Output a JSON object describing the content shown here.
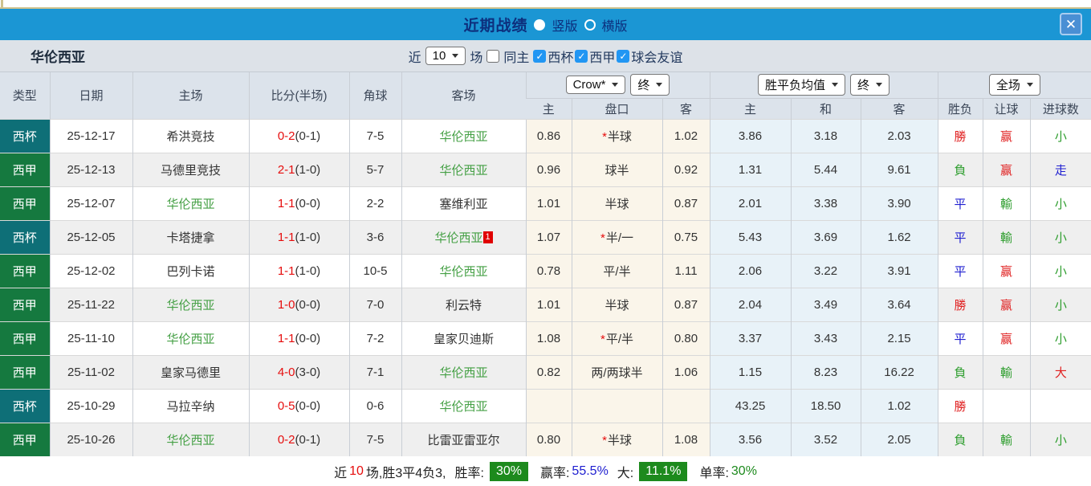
{
  "colors": {
    "accent_blue": "#1b96d4",
    "title_navy": "#0d2f7d",
    "cup_badge": "#0e6f77",
    "league_badge": "#15793f",
    "badge_green": "#1d8a1d",
    "win_red": "#e02020",
    "lose_green": "#2f9e2f",
    "draw_blue": "#2020d0"
  },
  "titlebar": {
    "title": "近期战绩",
    "radio_vertical": "竖版",
    "radio_horizontal": "横版",
    "close_icon": "✕"
  },
  "filterbar": {
    "team": "华伦西亚",
    "near_label": "近",
    "matches_value": "10",
    "matches_suffix": "场",
    "same_home_label": "同主",
    "checkbox_glyph": "✓",
    "filters": [
      {
        "label": "西杯",
        "checked": true
      },
      {
        "label": "西甲",
        "checked": true
      },
      {
        "label": "球会友谊",
        "checked": true
      }
    ]
  },
  "table": {
    "headers_left": [
      "类型",
      "日期",
      "主场",
      "比分(半场)",
      "角球",
      "客场"
    ],
    "group1": {
      "select1": "Crow*",
      "select2": "终",
      "cols": [
        "主",
        "盘口",
        "客"
      ]
    },
    "group2": {
      "select1": "胜平负均值",
      "select2": "终",
      "cols": [
        "主",
        "和",
        "客"
      ]
    },
    "group3": {
      "select1": "全场",
      "cols": [
        "胜负",
        "让球",
        "进球数"
      ]
    },
    "rows": [
      {
        "type": "西杯",
        "type_color": "teal",
        "date": "25-12-17",
        "home": "希洪竞技",
        "home_self": false,
        "score_ft": "0-2",
        "score_ht": "(0-1)",
        "corner": "7-5",
        "away": "华伦西亚",
        "away_self": true,
        "away_badge": "",
        "odds_home": "0.86",
        "handicap": "*半球",
        "odds_away": "1.02",
        "avg_home": "3.86",
        "avg_draw": "3.18",
        "avg_away": "2.03",
        "outcome": {
          "t": "勝",
          "c": "red"
        },
        "handicap_res": {
          "t": "赢",
          "c": "red"
        },
        "goals": {
          "t": "小",
          "c": "green"
        }
      },
      {
        "type": "西甲",
        "type_color": "green",
        "date": "25-12-13",
        "home": "马德里竞技",
        "home_self": false,
        "score_ft": "2-1",
        "score_ht": "(1-0)",
        "corner": "5-7",
        "away": "华伦西亚",
        "away_self": true,
        "away_badge": "",
        "odds_home": "0.96",
        "handicap": "球半",
        "odds_away": "0.92",
        "avg_home": "1.31",
        "avg_draw": "5.44",
        "avg_away": "9.61",
        "outcome": {
          "t": "負",
          "c": "green"
        },
        "handicap_res": {
          "t": "赢",
          "c": "red"
        },
        "goals": {
          "t": "走",
          "c": "blue"
        }
      },
      {
        "type": "西甲",
        "type_color": "green",
        "date": "25-12-07",
        "home": "华伦西亚",
        "home_self": true,
        "score_ft": "1-1",
        "score_ht": "(0-0)",
        "corner": "2-2",
        "away": "塞维利亚",
        "away_self": false,
        "away_badge": "",
        "odds_home": "1.01",
        "handicap": "半球",
        "odds_away": "0.87",
        "avg_home": "2.01",
        "avg_draw": "3.38",
        "avg_away": "3.90",
        "outcome": {
          "t": "平",
          "c": "blue"
        },
        "handicap_res": {
          "t": "輸",
          "c": "green"
        },
        "goals": {
          "t": "小",
          "c": "green"
        }
      },
      {
        "type": "西杯",
        "type_color": "teal",
        "date": "25-12-05",
        "home": "卡塔捷拿",
        "home_self": false,
        "score_ft": "1-1",
        "score_ht": "(1-0)",
        "corner": "3-6",
        "away": "华伦西亚",
        "away_self": true,
        "away_badge": "1",
        "odds_home": "1.07",
        "handicap": "*半/一",
        "odds_away": "0.75",
        "avg_home": "5.43",
        "avg_draw": "3.69",
        "avg_away": "1.62",
        "outcome": {
          "t": "平",
          "c": "blue"
        },
        "handicap_res": {
          "t": "輸",
          "c": "green"
        },
        "goals": {
          "t": "小",
          "c": "green"
        }
      },
      {
        "type": "西甲",
        "type_color": "green",
        "date": "25-12-02",
        "home": "巴列卡诺",
        "home_self": false,
        "score_ft": "1-1",
        "score_ht": "(1-0)",
        "corner": "10-5",
        "away": "华伦西亚",
        "away_self": true,
        "away_badge": "",
        "odds_home": "0.78",
        "handicap": "平/半",
        "odds_away": "1.11",
        "avg_home": "2.06",
        "avg_draw": "3.22",
        "avg_away": "3.91",
        "outcome": {
          "t": "平",
          "c": "blue"
        },
        "handicap_res": {
          "t": "赢",
          "c": "red"
        },
        "goals": {
          "t": "小",
          "c": "green"
        }
      },
      {
        "type": "西甲",
        "type_color": "green",
        "date": "25-11-22",
        "home": "华伦西亚",
        "home_self": true,
        "score_ft": "1-0",
        "score_ht": "(0-0)",
        "corner": "7-0",
        "away": "利云特",
        "away_self": false,
        "away_badge": "",
        "odds_home": "1.01",
        "handicap": "半球",
        "odds_away": "0.87",
        "avg_home": "2.04",
        "avg_draw": "3.49",
        "avg_away": "3.64",
        "outcome": {
          "t": "勝",
          "c": "red"
        },
        "handicap_res": {
          "t": "赢",
          "c": "red"
        },
        "goals": {
          "t": "小",
          "c": "green"
        }
      },
      {
        "type": "西甲",
        "type_color": "green",
        "date": "25-11-10",
        "home": "华伦西亚",
        "home_self": true,
        "score_ft": "1-1",
        "score_ht": "(0-0)",
        "corner": "7-2",
        "away": "皇家贝迪斯",
        "away_self": false,
        "away_badge": "",
        "odds_home": "1.08",
        "handicap": "*平/半",
        "odds_away": "0.80",
        "avg_home": "3.37",
        "avg_draw": "3.43",
        "avg_away": "2.15",
        "outcome": {
          "t": "平",
          "c": "blue"
        },
        "handicap_res": {
          "t": "赢",
          "c": "red"
        },
        "goals": {
          "t": "小",
          "c": "green"
        }
      },
      {
        "type": "西甲",
        "type_color": "green",
        "date": "25-11-02",
        "home": "皇家马德里",
        "home_self": false,
        "score_ft": "4-0",
        "score_ht": "(3-0)",
        "corner": "7-1",
        "away": "华伦西亚",
        "away_self": true,
        "away_badge": "",
        "odds_home": "0.82",
        "handicap": "两/两球半",
        "odds_away": "1.06",
        "avg_home": "1.15",
        "avg_draw": "8.23",
        "avg_away": "16.22",
        "outcome": {
          "t": "負",
          "c": "green"
        },
        "handicap_res": {
          "t": "輸",
          "c": "green"
        },
        "goals": {
          "t": "大",
          "c": "red"
        }
      },
      {
        "type": "西杯",
        "type_color": "teal",
        "date": "25-10-29",
        "home": "马拉辛纳",
        "home_self": false,
        "score_ft": "0-5",
        "score_ht": "(0-0)",
        "corner": "0-6",
        "away": "华伦西亚",
        "away_self": true,
        "away_badge": "",
        "odds_home": "",
        "handicap": "",
        "odds_away": "",
        "avg_home": "43.25",
        "avg_draw": "18.50",
        "avg_away": "1.02",
        "outcome": {
          "t": "勝",
          "c": "red"
        },
        "handicap_res": {
          "t": "",
          "c": ""
        },
        "goals": {
          "t": "",
          "c": ""
        }
      },
      {
        "type": "西甲",
        "type_color": "green",
        "date": "25-10-26",
        "home": "华伦西亚",
        "home_self": true,
        "score_ft": "0-2",
        "score_ht": "(0-1)",
        "corner": "7-5",
        "away": "比雷亚雷亚尔",
        "away_self": false,
        "away_badge": "",
        "odds_home": "0.80",
        "handicap": "*半球",
        "odds_away": "1.08",
        "avg_home": "3.56",
        "avg_draw": "3.52",
        "avg_away": "2.05",
        "outcome": {
          "t": "負",
          "c": "green"
        },
        "handicap_res": {
          "t": "輸",
          "c": "green"
        },
        "goals": {
          "t": "小",
          "c": "green"
        }
      }
    ]
  },
  "summary": {
    "near_label": "近",
    "count": "10",
    "mid": "场,胜3平4负3,",
    "win_rate_label": "胜率:",
    "win_rate": "30%",
    "win_odds_label": "赢率:",
    "win_odds": "55.5%",
    "big_label": "大:",
    "big": "11.1%",
    "single_label": "单率:",
    "single": "30%"
  }
}
